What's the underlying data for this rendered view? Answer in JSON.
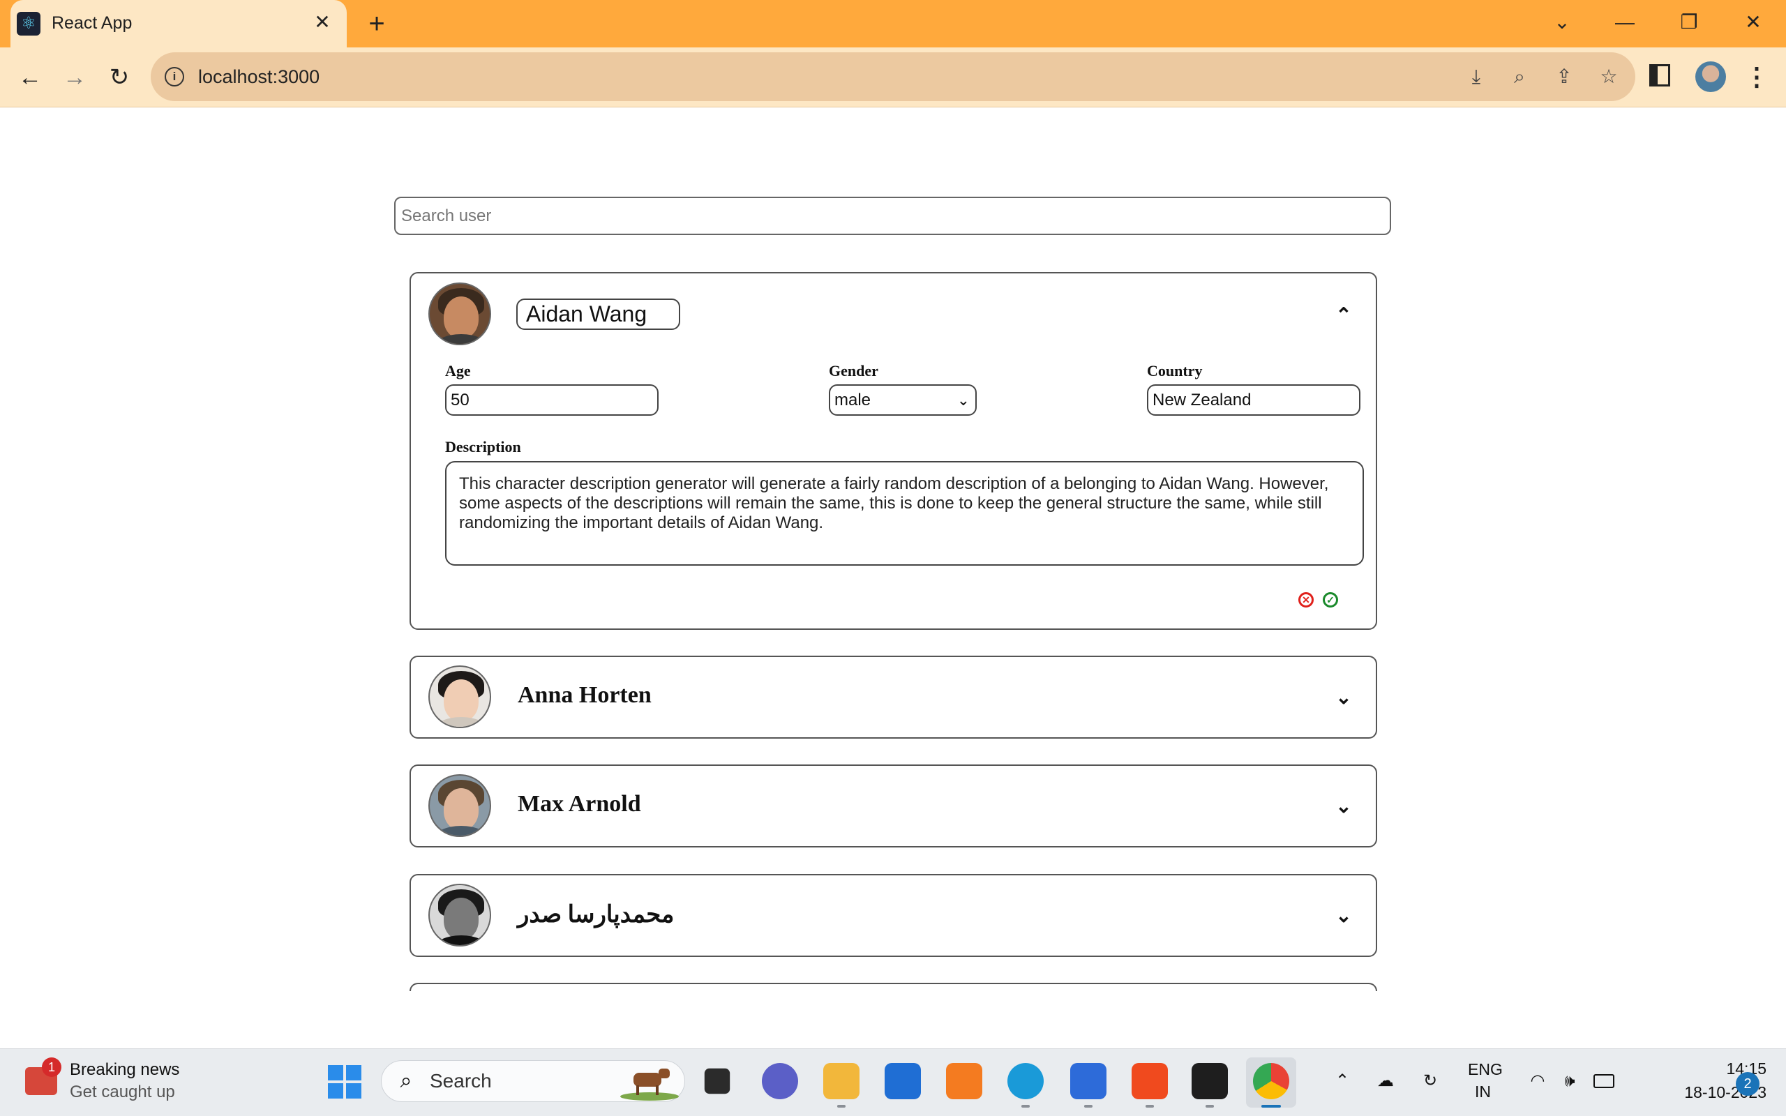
{
  "browser": {
    "tab_title": "React App",
    "url": "localhost:3000"
  },
  "page": {
    "search_placeholder": "Search user",
    "expanded_user": {
      "name": "Aidan Wang",
      "labels": {
        "age": "Age",
        "gender": "Gender",
        "country": "Country",
        "description": "Description"
      },
      "age": "50",
      "gender": "male",
      "country": "New Zealand",
      "description": "This character description generator will generate a fairly random description of a belonging to Aidan Wang. However, some aspects of the descriptions will remain the same, this is done to keep the general structure the same, while still randomizing the important details of Aidan Wang."
    },
    "collapsed_users": [
      {
        "name": "Anna Horten"
      },
      {
        "name": "Max Arnold"
      },
      {
        "name": "محمدپارسا صدر"
      }
    ],
    "colors": {
      "cancel": "#e0201b",
      "confirm": "#1b8a2c"
    }
  },
  "taskbar": {
    "news_title": "Breaking news",
    "news_subtitle": "Get caught up",
    "news_badge": "1",
    "search_label": "Search",
    "language": "ENG",
    "region": "IN",
    "time": "14:15",
    "date": "18-10-2023",
    "notifications": "2"
  }
}
